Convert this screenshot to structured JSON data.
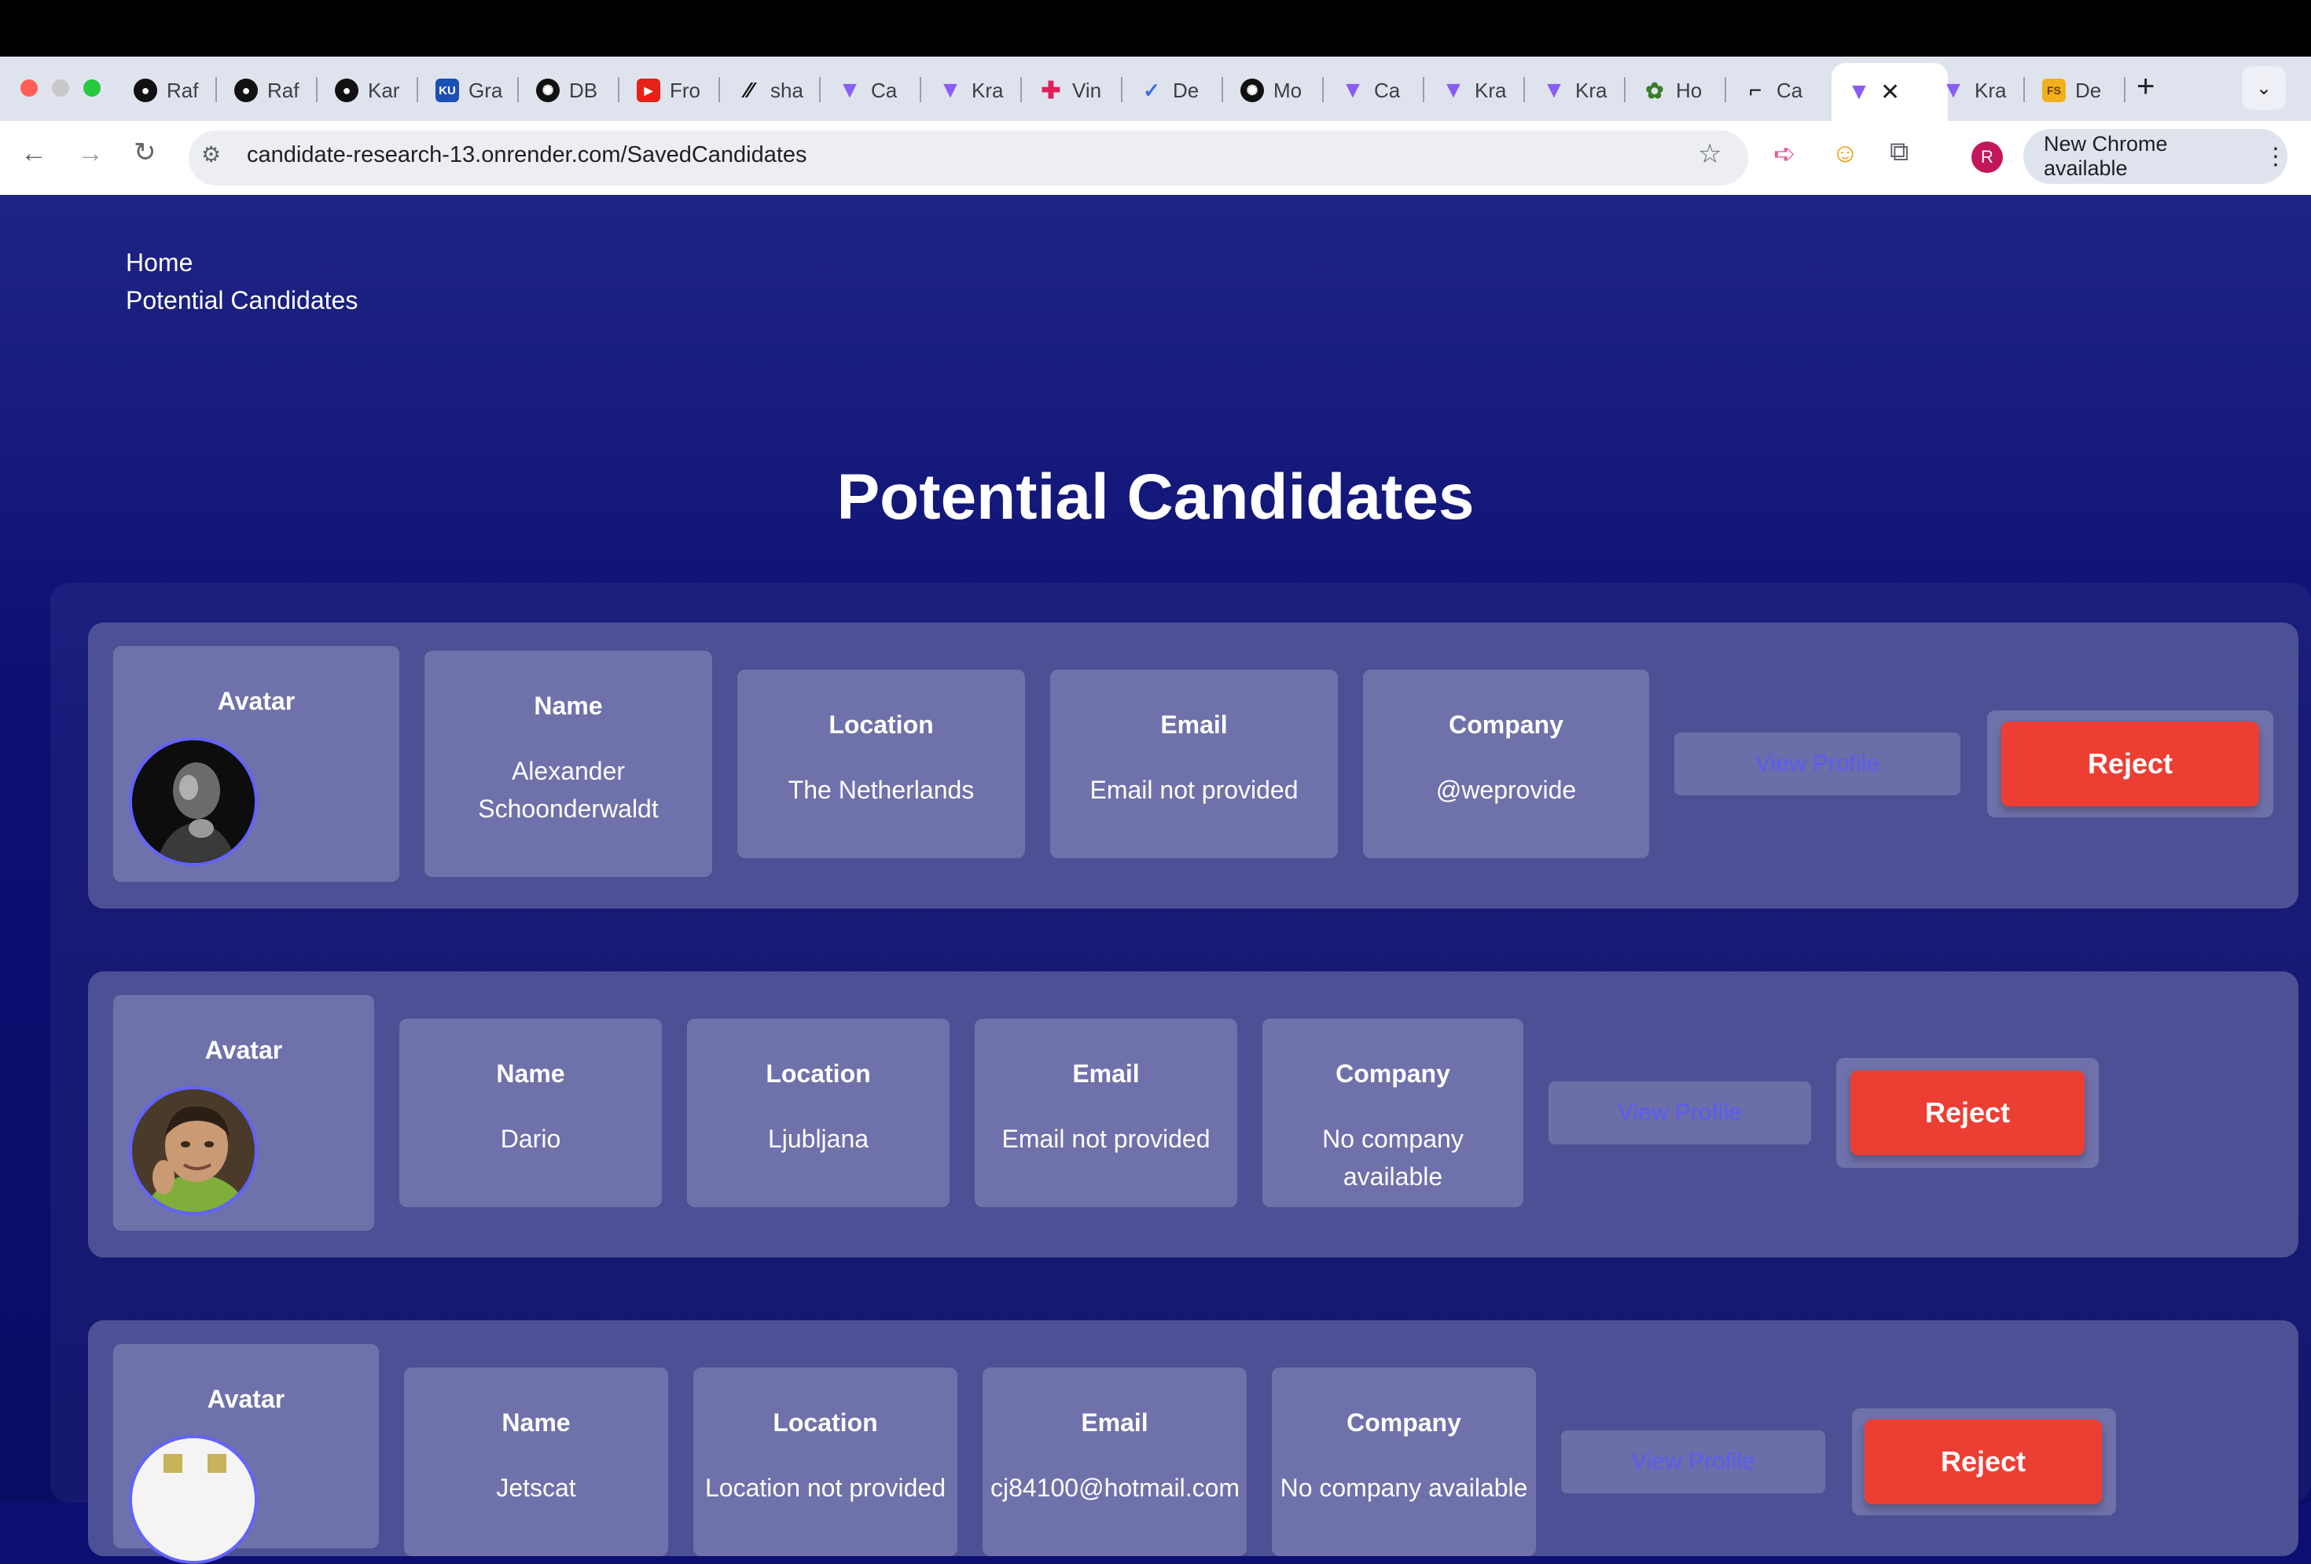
{
  "browser": {
    "tabs": [
      {
        "label": "Raf",
        "icon": "github-icon"
      },
      {
        "label": "Raf",
        "icon": "github-icon"
      },
      {
        "label": "Kar",
        "icon": "github-icon"
      },
      {
        "label": "Gra",
        "icon": "ku-icon"
      },
      {
        "label": "DB",
        "icon": "openai-icon"
      },
      {
        "label": "Fro",
        "icon": "youtube-icon"
      },
      {
        "label": "sha",
        "icon": "slash-icon"
      },
      {
        "label": "Ca",
        "icon": "vite-icon"
      },
      {
        "label": "Kra",
        "icon": "vite-icon"
      },
      {
        "label": "Vin",
        "icon": "slack-icon"
      },
      {
        "label": "De",
        "icon": "bird-icon"
      },
      {
        "label": "Mo",
        "icon": "openai-icon"
      },
      {
        "label": "Ca",
        "icon": "vite-icon"
      },
      {
        "label": "Kra",
        "icon": "vite-icon"
      },
      {
        "label": "Kra",
        "icon": "vite-icon"
      },
      {
        "label": "Ho",
        "icon": "globe-icon"
      },
      {
        "label": "Ca",
        "icon": "render-icon"
      },
      {
        "label": "",
        "icon": "vite-icon",
        "active": true
      },
      {
        "label": "Kra",
        "icon": "vite-icon"
      },
      {
        "label": "De",
        "icon": "fs-icon"
      }
    ],
    "url": "candidate-research-13.onrender.com/SavedCandidates",
    "profile_initial": "R",
    "update_label": "New Chrome available"
  },
  "nav": {
    "home": "Home",
    "potential": "Potential Candidates"
  },
  "page": {
    "title": "Potential Candidates"
  },
  "headers": {
    "avatar": "Avatar",
    "name": "Name",
    "location": "Location",
    "email": "Email",
    "company": "Company"
  },
  "candidates": [
    {
      "name_line1": "Alexander",
      "name_line2": "Schoonderwaldt",
      "location": "The Netherlands",
      "email": "Email not provided",
      "company": "@weprovide",
      "view_label": "View Profile",
      "reject_label": "Reject"
    },
    {
      "name_line1": "Dario",
      "name_line2": "",
      "location": "Ljubljana",
      "email": "Email not provided",
      "company": "No company available",
      "view_label": "View Profile",
      "reject_label": "Reject"
    },
    {
      "name_line1": "Jetscat",
      "name_line2": "",
      "location": "Location not provided",
      "email": "cj84100@hotmail.com",
      "company": "No company available",
      "view_label": "View Profile",
      "reject_label": "Reject"
    }
  ],
  "colors": {
    "accent_reject": "#ed3e34",
    "link_blue": "#5b5cf2",
    "page_bg": "#0e0f73"
  }
}
